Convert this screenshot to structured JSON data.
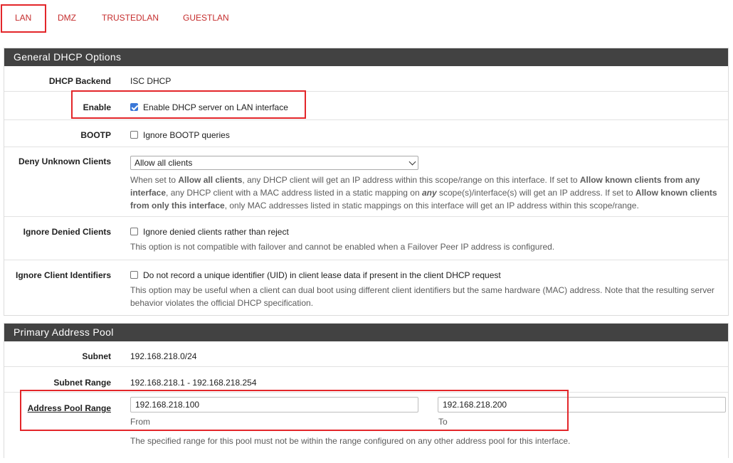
{
  "tabs": [
    "LAN",
    "DMZ",
    "TRUSTEDLAN",
    "GUESTLAN"
  ],
  "general": {
    "title": "General DHCP Options",
    "backend_label": "DHCP Backend",
    "backend_value": "ISC DHCP",
    "enable_label": "Enable",
    "enable_text": "Enable DHCP server on LAN interface",
    "enable_checked": true,
    "bootp_label": "BOOTP",
    "bootp_text": "Ignore BOOTP queries",
    "deny_label": "Deny Unknown Clients",
    "deny_selected": "Allow all clients",
    "deny_help": {
      "p1": "When set to ",
      "b1": "Allow all clients",
      "p2": ", any DHCP client will get an IP address within this scope/range on this interface. If set to ",
      "b2": "Allow known clients from any interface",
      "p3": ", any DHCP client with a MAC address listed in a static mapping on ",
      "b3": "any",
      "p4": " scope(s)/interface(s) will get an IP address. If set to ",
      "b4": "Allow known clients from only this interface",
      "p5": ", only MAC addresses listed in static mappings on this interface will get an IP address within this scope/range."
    },
    "ignore_denied_label": "Ignore Denied Clients",
    "ignore_denied_text": "Ignore denied clients rather than reject",
    "ignore_denied_help": "This option is not compatible with failover and cannot be enabled when a Failover Peer IP address is configured.",
    "ignore_uid_label": "Ignore Client Identifiers",
    "ignore_uid_text": "Do not record a unique identifier (UID) in client lease data if present in the client DHCP request",
    "ignore_uid_help": "This option may be useful when a client can dual boot using different client identifiers but the same hardware (MAC) address. Note that the resulting server behavior violates the official DHCP specification."
  },
  "pool": {
    "title": "Primary Address Pool",
    "subnet_label": "Subnet",
    "subnet_value": "192.168.218.0/24",
    "range_label": "Subnet Range",
    "range_value": "192.168.218.1 - 192.168.218.254",
    "pool_label": "Address Pool Range",
    "from_value": "192.168.218.100",
    "from_label": "From",
    "to_value": "192.168.218.200",
    "to_label": "To",
    "help": "The specified range for this pool must not be within the range configured on any other address pool for this interface."
  },
  "colors": {
    "accent": "#c52d2d",
    "highlight": "#e3262a",
    "panel_header": "#424242",
    "checkbox": "#3b78d8"
  }
}
